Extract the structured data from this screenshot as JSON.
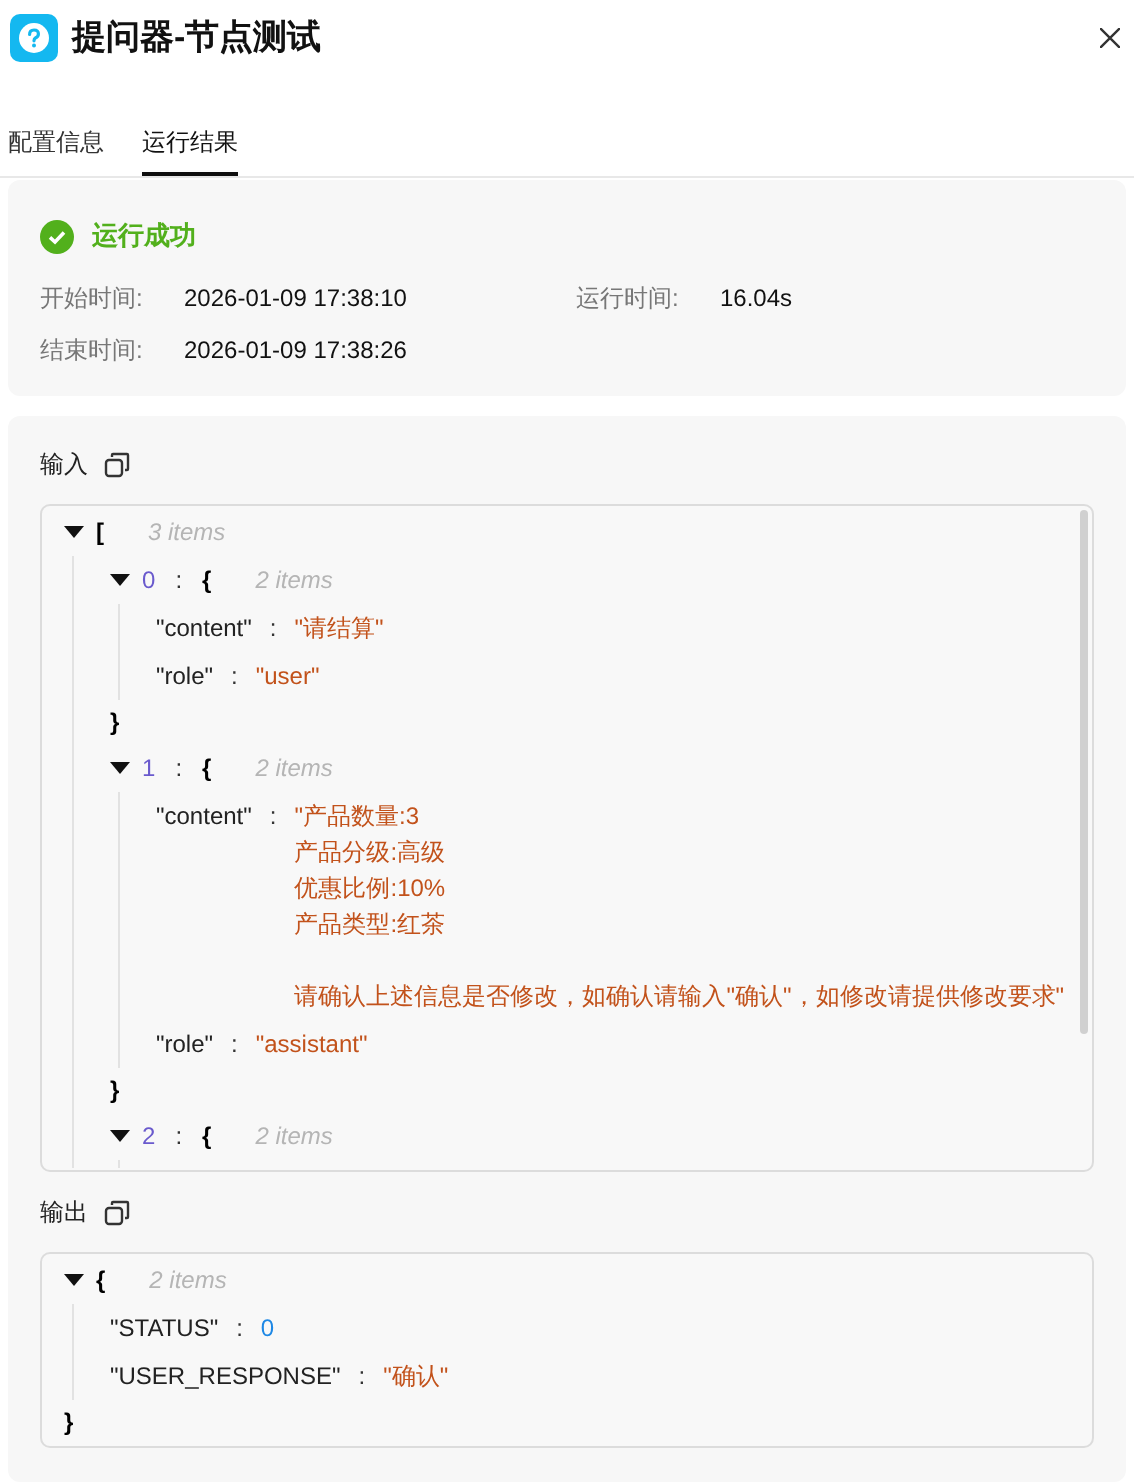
{
  "dialog": {
    "title": "提问器-节点测试"
  },
  "tabs": [
    {
      "label": "配置信息",
      "selected": false
    },
    {
      "label": "运行结果",
      "selected": true
    }
  ],
  "result": {
    "status_text": "运行成功",
    "fields": [
      {
        "label": "开始时间:",
        "value": "2026-01-09 17:38:10"
      },
      {
        "label": "运行时间:",
        "value": "16.04s"
      },
      {
        "label": "结束时间:",
        "value": "2026-01-09 17:38:26"
      }
    ]
  },
  "input": {
    "label": "输入",
    "tree": {
      "kind": "container",
      "expanded": true,
      "open": "[",
      "count": "3 items",
      "children": [
        {
          "kind": "container",
          "key": "0",
          "colon": ":",
          "expanded": true,
          "open": "{",
          "count": "2 items",
          "close": "}",
          "children": [
            {
              "kind": "string",
              "key": "\"content\"",
              "colon": ":",
              "value": "\"请结算\""
            },
            {
              "kind": "string",
              "key": "\"role\"",
              "colon": ":",
              "value": "\"user\""
            }
          ]
        },
        {
          "kind": "container",
          "key": "1",
          "colon": ":",
          "expanded": true,
          "open": "{",
          "count": "2 items",
          "close": "}",
          "children": [
            {
              "kind": "multiline",
              "key": "\"content\"",
              "colon": ":",
              "lines": [
                {
                  "text": "\"产品数量:3",
                  "space_before": false
                },
                {
                  "text": "产品分级:高级",
                  "space_before": false
                },
                {
                  "text": "优惠比例:10%",
                  "space_before": false
                },
                {
                  "text": "产品类型:红茶",
                  "space_before": false
                },
                {
                  "text": "请确认上述信息是否修改，如确认请输入\"确认\"，如修改请提供修改要求\"",
                  "space_before": true
                }
              ]
            },
            {
              "kind": "string",
              "key": "\"role\"",
              "colon": ":",
              "value": "\"assistant\""
            }
          ]
        },
        {
          "kind": "container",
          "key": "2",
          "colon": ":",
          "expanded": true,
          "open": "{",
          "count": "2 items"
        }
      ]
    }
  },
  "output": {
    "label": "输出",
    "tree": {
      "kind": "container",
      "expanded": true,
      "open": "{",
      "count": "2 items",
      "close": "}",
      "children": [
        {
          "kind": "number",
          "key": "\"STATUS\"",
          "colon": ":",
          "value": "0"
        },
        {
          "kind": "string",
          "key": "\"USER_RESPONSE\"",
          "colon": ":",
          "value": "\"确认\""
        }
      ]
    }
  }
}
